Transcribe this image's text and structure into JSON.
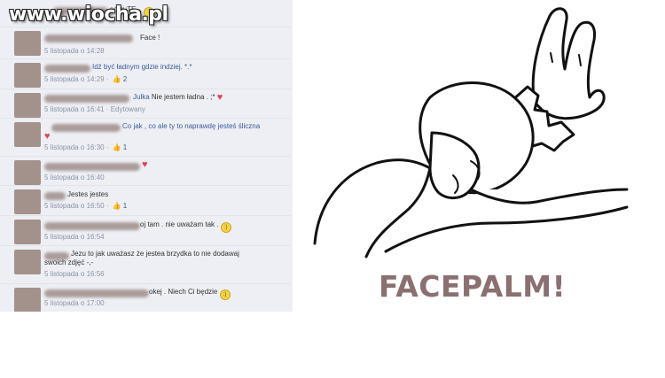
{
  "watermark": "www.wiocha.pl",
  "comments": [
    {
      "text": "so cuTE...",
      "emoji": "smile",
      "meta": ""
    },
    {
      "text": "Face !",
      "emoji": "",
      "meta": "5 listopada o 14:28"
    },
    {
      "text": "Idź być ładnym gdzie indziej. *.*",
      "emoji": "",
      "meta": "5 listopada o 14:29",
      "likes": "2"
    },
    {
      "mention": "Julka",
      "text": "Nie jestem ładna . ;*",
      "emoji": "heart",
      "meta": "5 listopada o 16:41 · Edytowany"
    },
    {
      "text": "Co jak , co ale ty to naprawdę jesteś śliczna",
      "emoji": "heart",
      "meta": "5 listopada o 16:30",
      "likes": "1"
    },
    {
      "text": "",
      "emoji": "heart",
      "meta": "5 listopada o 16:40"
    },
    {
      "text": "Jestes jestes",
      "emoji": "",
      "meta": "5 listopada o 16:50",
      "likes": "1"
    },
    {
      "text": "oj tam . nie uważam tak .",
      "emoji": "smile",
      "meta": "5 listopada o 16:54"
    },
    {
      "text": "Jezu to jak uważasz że jestea brzydka to nie dodawaj",
      "text2": "swoich zdjęć -,-",
      "emoji": "",
      "meta": "5 listopada o 16:56"
    },
    {
      "text": "okej . Niech Ci będzie",
      "emoji": "wink",
      "meta": "5 listopada o 17:00"
    }
  ],
  "caption": "FACEPALM!"
}
